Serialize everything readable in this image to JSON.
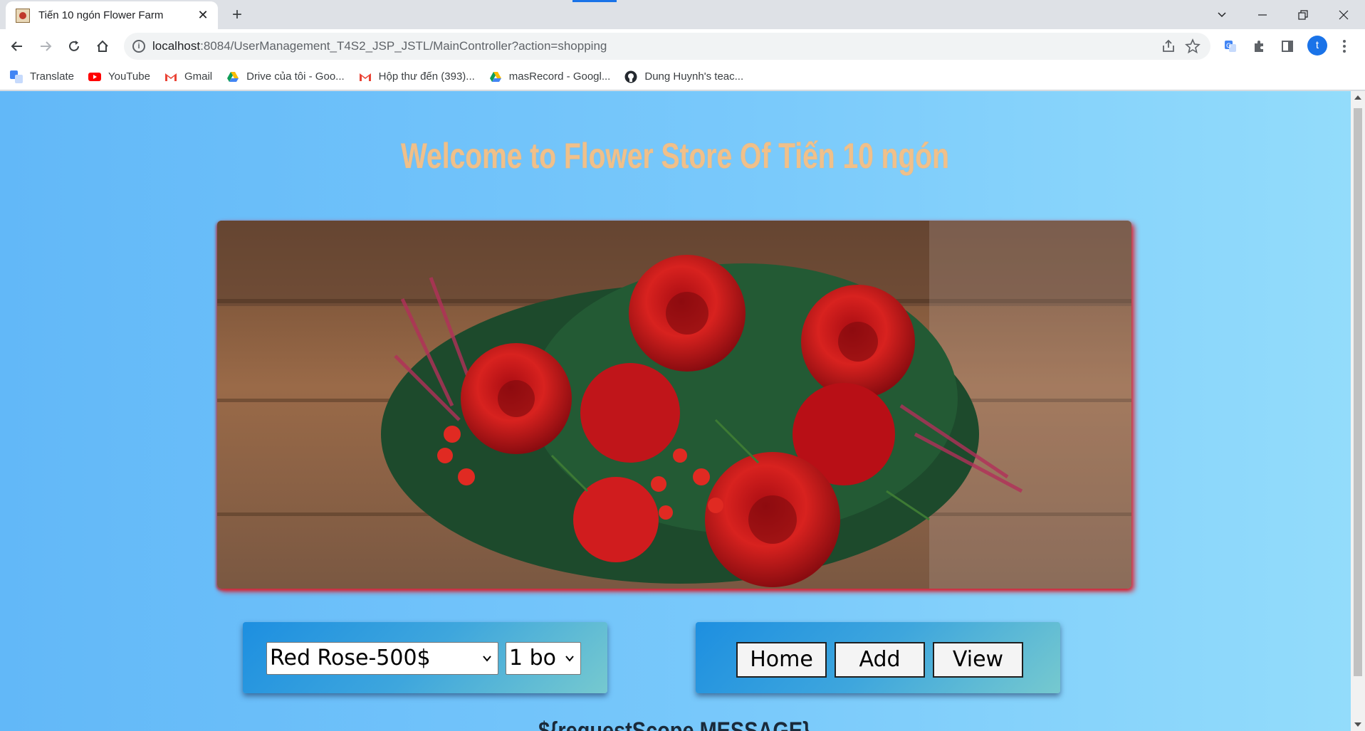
{
  "browser": {
    "tab": {
      "title": "Tiến 10 ngón Flower Farm"
    },
    "address": {
      "host": "localhost",
      "rest": ":8084/UserManagement_T4S2_JSP_JSTL/MainController?action=shopping"
    },
    "profile_initial": "t",
    "bookmarks": [
      {
        "label": "Translate",
        "icon": "google-translate-icon"
      },
      {
        "label": "YouTube",
        "icon": "youtube-icon"
      },
      {
        "label": "Gmail",
        "icon": "gmail-icon"
      },
      {
        "label": "Drive của tôi - Goo...",
        "icon": "google-drive-icon"
      },
      {
        "label": "Hộp thư đến (393)...",
        "icon": "gmail-icon"
      },
      {
        "label": "masRecord - Googl...",
        "icon": "google-drive-icon"
      },
      {
        "label": "Dung Huynh's teac...",
        "icon": "github-icon"
      }
    ]
  },
  "page": {
    "title": "Welcome to Flower Store Of Tiến 10 ngón",
    "title_color": "#f0c08a",
    "hero_image": "red-rose-bouquet",
    "flower_select": {
      "selected": "Red Rose-500$"
    },
    "quantity_select": {
      "selected": "1 bo"
    },
    "buttons": {
      "home": "Home",
      "add": "Add",
      "view": "View"
    },
    "message": "${requestScope.MESSAGE}"
  }
}
